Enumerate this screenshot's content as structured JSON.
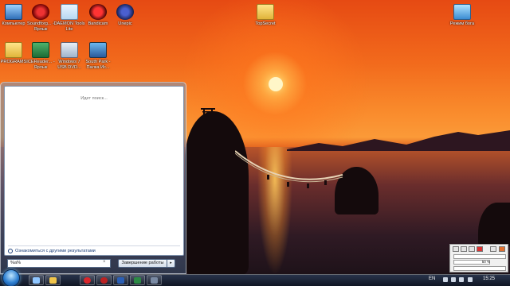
{
  "desktop": {
    "icons": [
      {
        "label": "Компьютер",
        "icon": "computer-icon"
      },
      {
        "label": "Soundforg... - Ярлык",
        "icon": "soundforge-icon"
      },
      {
        "label": "DAEMON Tools Lite",
        "icon": "daemon-tools-icon"
      },
      {
        "label": "Bandicam",
        "icon": "bandicam-icon"
      },
      {
        "label": "Unepic",
        "icon": "unepic-icon"
      },
      {
        "label": "TopSecret",
        "icon": "folder-icon"
      },
      {
        "label": "Режим бога",
        "icon": "godmode-icon"
      },
      {
        "label": "PROGRAMS",
        "icon": "folder-icon"
      },
      {
        "label": "ICEReader... - Ярлык",
        "icon": "icereader-icon"
      },
      {
        "label": "Windows 7 USB DVD...",
        "icon": "win7-usb-icon"
      },
      {
        "label": "South Park - Палка Ис...",
        "icon": "southpark-icon"
      }
    ]
  },
  "start_menu": {
    "status": "Идет поиск...",
    "more_results": "Ознакомиться с другими результатами",
    "search": {
      "value": "%a%",
      "clear": "×"
    },
    "shutdown_label": "Завершение работы",
    "shutdown_arrow": "▸"
  },
  "widget": {
    "value": "50 %"
  },
  "taskbar": {
    "pinned": [
      "explorer-icon",
      "folder-icon",
      "opera-icon",
      "media-icon",
      "word-icon",
      "excel-icon",
      "app-icon"
    ],
    "language": "EN",
    "clock": "15:25"
  }
}
